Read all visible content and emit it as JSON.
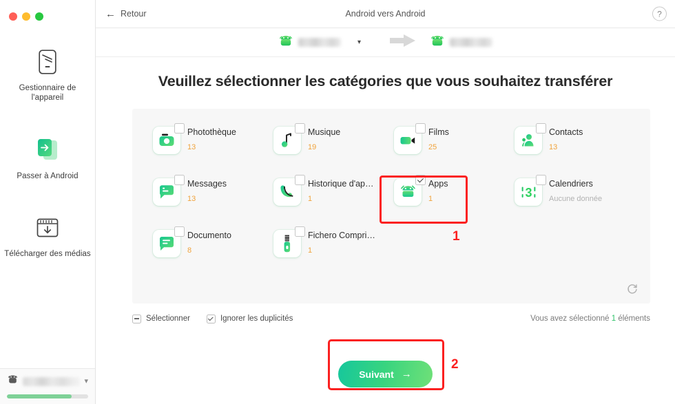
{
  "window": {
    "traffic_lights": [
      "close",
      "minimize",
      "maximize"
    ]
  },
  "sidebar": {
    "items": [
      {
        "icon": "device-manager-icon",
        "label": "Gestionnaire de l'appareil"
      },
      {
        "icon": "switch-to-android-icon",
        "label": "Passer à Android"
      },
      {
        "icon": "download-media-icon",
        "label": "Télécharger des médias"
      }
    ],
    "device_bar": {
      "icon": "android-robot-icon",
      "device_name": "",
      "dropdown_icon": "chevron-down-icon",
      "storage_percent": 80
    }
  },
  "topbar": {
    "back_label": "Retour",
    "back_icon": "arrow-left-icon",
    "title": "Android vers Android",
    "help_label": "?"
  },
  "device_transfer": {
    "source_icon": "android-robot-icon",
    "source_name": "",
    "dropdown_icon": "chevron-down-icon",
    "arrow_icon": "arrow-right-icon",
    "target_icon": "android-robot-icon",
    "target_name": ""
  },
  "main": {
    "heading": "Veuillez sélectionner les catégories que vous souhaitez transférer",
    "categories": [
      {
        "icon": "camera-icon",
        "name": "Photothèque",
        "count": "13",
        "checked": false,
        "nodata": false
      },
      {
        "icon": "music-note-icon",
        "name": "Musique",
        "count": "19",
        "checked": false,
        "nodata": false
      },
      {
        "icon": "video-icon",
        "name": "Films",
        "count": "25",
        "checked": false,
        "nodata": false
      },
      {
        "icon": "contact-icon",
        "name": "Contacts",
        "count": "13",
        "checked": false,
        "nodata": false
      },
      {
        "icon": "message-icon",
        "name": "Messages",
        "count": "13",
        "checked": false,
        "nodata": false
      },
      {
        "icon": "phone-icon",
        "name": "Historique d'ap…",
        "count": "1",
        "checked": false,
        "nodata": false
      },
      {
        "icon": "apps-icon",
        "name": "Apps",
        "count": "1",
        "checked": true,
        "nodata": false
      },
      {
        "icon": "calendar-icon",
        "name": "Calendriers",
        "count": "Aucune donnée",
        "checked": false,
        "nodata": true
      },
      {
        "icon": "document-icon",
        "name": "Documento",
        "count": "8",
        "checked": false,
        "nodata": false
      },
      {
        "icon": "zip-icon",
        "name": "Fichero Compri…",
        "count": "1",
        "checked": false,
        "nodata": false
      }
    ],
    "refresh_icon": "refresh-icon"
  },
  "footer": {
    "select_all_label": "Sélectionner",
    "select_all_state": "indeterminate",
    "ignore_duplicates_label": "Ignorer les duplicités",
    "ignore_duplicates_state": "checked",
    "selection_info_prefix": "Vous avez sélectionné ",
    "selection_count": "1",
    "selection_info_suffix": " éléments"
  },
  "next_button": {
    "label": "Suivant",
    "arrow_icon": "arrow-right-icon"
  },
  "annotations": [
    {
      "number": "1",
      "target": "apps-category"
    },
    {
      "number": "2",
      "target": "next-button"
    }
  ],
  "colors": {
    "accent_green": "#2fc36a",
    "count_orange": "#f0a33c",
    "highlight_red": "#fb2020",
    "panel_bg": "#f7f7f7"
  }
}
